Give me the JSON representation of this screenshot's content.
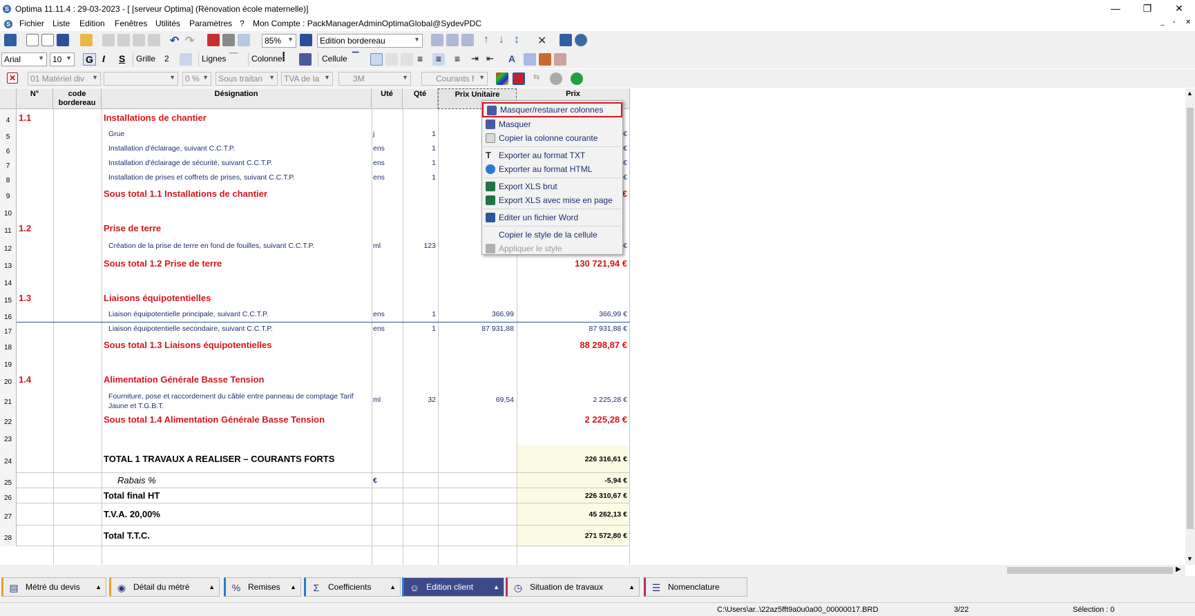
{
  "window": {
    "title": "Optima 11.11.4 : 29-03-2023 - [ [serveur Optima] (Rénovation école maternelle)]",
    "minimize": "—",
    "restore": "❐",
    "close": "✕"
  },
  "menu": {
    "items": [
      "Fichier",
      "Liste",
      "Edition",
      "Fenêtres",
      "Utilités",
      "Paramètres",
      "?"
    ],
    "account": "Mon Compte : PackManagerAdminOptimaGlobal@SydevPDC"
  },
  "toolbar1": {
    "zoom": "85%",
    "view": "Edition bordereau"
  },
  "toolbar2": {
    "font": "Arial",
    "font_size": "10",
    "bold": "G",
    "italic": "I",
    "strike": "S",
    "grid_label": "Grille",
    "grid_value": "2",
    "lines_label": "Lignes",
    "column_label": "Colonne",
    "cell_label": "Cellule"
  },
  "toolbar3": {
    "material": "01  Matériel div",
    "empty": "",
    "percent": "0 %",
    "subcontract": "Sous traitan",
    "tva": "TVA de la",
    "lot": "3M",
    "currents": "Courants f"
  },
  "grid": {
    "headers": {
      "num": "N°",
      "code": "code bordereau",
      "designation": "Désignation",
      "unit": "Uté",
      "qty": "Qté",
      "price_unit": "Prix Unitaire",
      "price": "Prix"
    },
    "rows": [
      {
        "n": "4",
        "num": "1.1",
        "des": "Installations de chantier",
        "style": "section"
      },
      {
        "n": "5",
        "des": "Grue",
        "unit": "j",
        "qty": "1",
        "price": "€",
        "style": "item"
      },
      {
        "n": "6",
        "des": "Installation d'éclairage, suivant C.C.T.P.",
        "unit": "ens",
        "qty": "1",
        "price": "€",
        "style": "item"
      },
      {
        "n": "7",
        "des": "Installation d'éclairage de sécurité, suivant C.C.T.P.",
        "unit": "ens",
        "qty": "1",
        "price": "€",
        "style": "item"
      },
      {
        "n": "8",
        "des": "Installation de prises et coffrets de prises, suivant C.C.T.P.",
        "unit": "ens",
        "qty": "1",
        "price": "€",
        "style": "item"
      },
      {
        "n": "9",
        "des": "Sous total 1.1 Installations de chantier",
        "price": "€",
        "style": "subtotal"
      },
      {
        "n": "10",
        "style": "blank"
      },
      {
        "n": "11",
        "num": "1.2",
        "des": "Prise de terre",
        "style": "section"
      },
      {
        "n": "12",
        "des": "Création de la prise de terre en fond de fouilles, suivant C.C.T.P.",
        "unit": "ml",
        "qty": "123",
        "price": "€",
        "style": "item"
      },
      {
        "n": "13",
        "des": "Sous total 1.2 Prise de terre",
        "price": "130 721,94 €",
        "style": "subtotal"
      },
      {
        "n": "14",
        "style": "blank"
      },
      {
        "n": "15",
        "num": "1.3",
        "des": "Liaisons équipotentielles",
        "style": "section"
      },
      {
        "n": "16",
        "des": "Liaison équipotentielle principale, suivant C.C.T.P.",
        "unit": "ens",
        "qty": "1",
        "pu": "366,99",
        "price": "366,99 €",
        "style": "item"
      },
      {
        "n": "17",
        "des": "Liaison équipotentielle secondaire, suivant C.C.T.P.",
        "unit": "ens",
        "qty": "1",
        "pu": "87 931,88",
        "price": "87 931,88 €",
        "style": "item"
      },
      {
        "n": "18",
        "des": "Sous total 1.3 Liaisons équipotentielles",
        "price": "88 298,87 €",
        "style": "subtotal"
      },
      {
        "n": "19",
        "style": "blank"
      },
      {
        "n": "20",
        "num": "1.4",
        "des": "Alimentation Générale Basse Tension",
        "style": "section"
      },
      {
        "n": "21",
        "des": "Fourniture, pose et raccordement du câble entre panneau de comptage Tarif",
        "des2": "Jaune et T.G.B.T.",
        "unit": "ml",
        "qty": "32",
        "pu": "69,54",
        "price": "2 225,28 €",
        "style": "item"
      },
      {
        "n": "22",
        "des": "Sous total 1.4 Alimentation Générale Basse Tension",
        "price": "2 225,28 €",
        "style": "subtotal"
      },
      {
        "n": "23",
        "style": "blank"
      },
      {
        "n": "24",
        "des": "TOTAL 1 TRAVAUX A REALISER – COURANTS FORTS",
        "price": "226 316,61 €",
        "style": "total"
      },
      {
        "n": "25",
        "des": "Rabais %",
        "unit": "€",
        "price": "-5,94 €",
        "style": "rabais"
      },
      {
        "n": "26",
        "des": "Total final HT",
        "price": "226 310,67 €",
        "style": "total"
      },
      {
        "n": "27",
        "des": "T.V.A. 20,00%",
        "price": "45 262,13 €",
        "style": "total"
      },
      {
        "n": "28",
        "des": "Total  T.T.C.",
        "price": "271 572,80 €",
        "style": "total"
      }
    ]
  },
  "context_menu": {
    "items": [
      "Masquer/restaurer colonnes",
      "Masquer",
      "Copier la colonne courante",
      "Exporter au format TXT",
      "Exporter au format HTML",
      "Export XLS brut",
      "Export XLS avec mise en page",
      "Editer un fichier Word",
      "Copier le style de la cellule",
      "Appliquer le style"
    ]
  },
  "tabs": [
    "Métré du devis",
    "Détail du métré",
    "Remises",
    "Coefficients",
    "Edition client",
    "Situation de travaux",
    "Nomenclature"
  ],
  "status": {
    "path": "C:\\Users\\ar..\\22az5fft9a0u0a00_00000017.BRD",
    "page": "3/22",
    "selection": "Sélection : 0"
  },
  "colors": {
    "accent_red": "#d7141a",
    "text_blue": "#1c2d6e",
    "active_tab": "#3c4a8c",
    "highlight_border": "#d7141a"
  }
}
